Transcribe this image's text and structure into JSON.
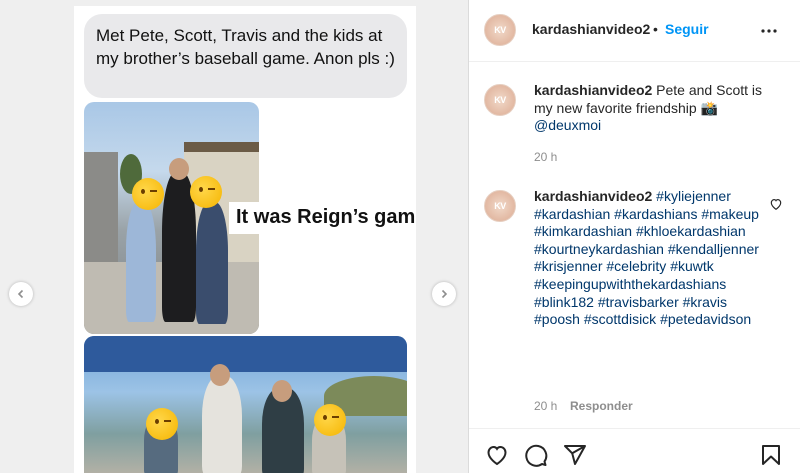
{
  "post": {
    "message_text": "Met Pete, Scott, Travis and the kids at my brother’s baseball game. Anon pls :)",
    "overlay_text": "It was Reign’s game"
  },
  "header": {
    "username": "kardashianvideo2",
    "separator": "•",
    "follow_label": "Seguir",
    "avatar_text": "KV"
  },
  "caption": {
    "username": "kardashianvideo2",
    "text": "Pete and Scott is my new favorite friendship 📸",
    "mention": "@deuxmoi",
    "time": "20 h"
  },
  "comment": {
    "username": "kardashianvideo2",
    "hashtags": [
      "#kyliejenner",
      "#kardashian",
      "#kardashians",
      "#makeup",
      "#kimkardashian",
      "#khloekardashian",
      "#kourtneykardashian",
      "#kendalljenner",
      "#krisjenner",
      "#celebrity",
      "#kuwtk",
      "#keepingupwiththekardashians",
      "#blink182",
      "#travisbarker",
      "#kravis",
      "#poosh",
      "#scottdisick",
      "#petedavidson"
    ],
    "time": "20 h",
    "reply_label": "Responder"
  },
  "icons": {
    "prev": "chevron-left-icon",
    "next": "chevron-right-icon",
    "more": "more-horizontal-icon",
    "like": "heart-icon",
    "comment": "comment-icon",
    "share": "send-icon",
    "save": "bookmark-icon"
  },
  "colors": {
    "link": "#0095f6",
    "hashtag": "#00376b",
    "muted": "#8e8e8e"
  }
}
